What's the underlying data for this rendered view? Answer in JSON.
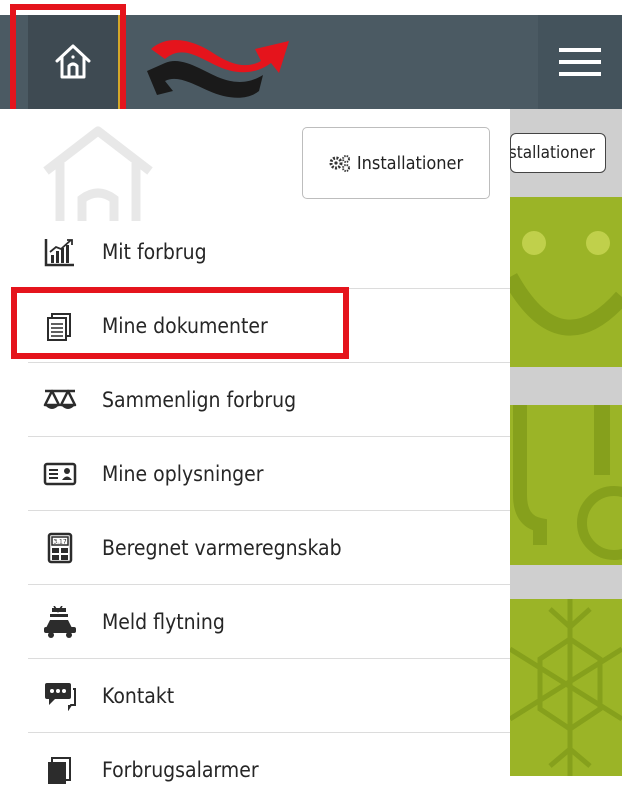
{
  "header": {
    "home_icon": "home-icon",
    "logo": "company-logo",
    "menu_icon": "hamburger-icon"
  },
  "drawer": {
    "installations_button": {
      "label": "Installationer",
      "icon": "gears-icon"
    },
    "menu_items": [
      {
        "label": "Mit forbrug",
        "icon": "chart-icon"
      },
      {
        "label": "Mine dokumenter",
        "icon": "documents-icon"
      },
      {
        "label": "Sammenlign forbrug",
        "icon": "scale-icon"
      },
      {
        "label": "Mine oplysninger",
        "icon": "id-card-icon"
      },
      {
        "label": "Beregnet varmeregnskab",
        "icon": "calculator-icon"
      },
      {
        "label": "Meld flytning",
        "icon": "moving-car-icon"
      },
      {
        "label": "Kontakt",
        "icon": "chat-icon"
      },
      {
        "label": "Forbrugsalarmer",
        "icon": "alarm-documents-icon"
      }
    ]
  },
  "background_page": {
    "installations_button_label": "Installationer"
  },
  "colors": {
    "header": "#4b5a63",
    "accent_green": "#9bb427",
    "highlight_red": "#e5141c",
    "logo_red": "#e5141c",
    "logo_black": "#1a1a1a"
  }
}
